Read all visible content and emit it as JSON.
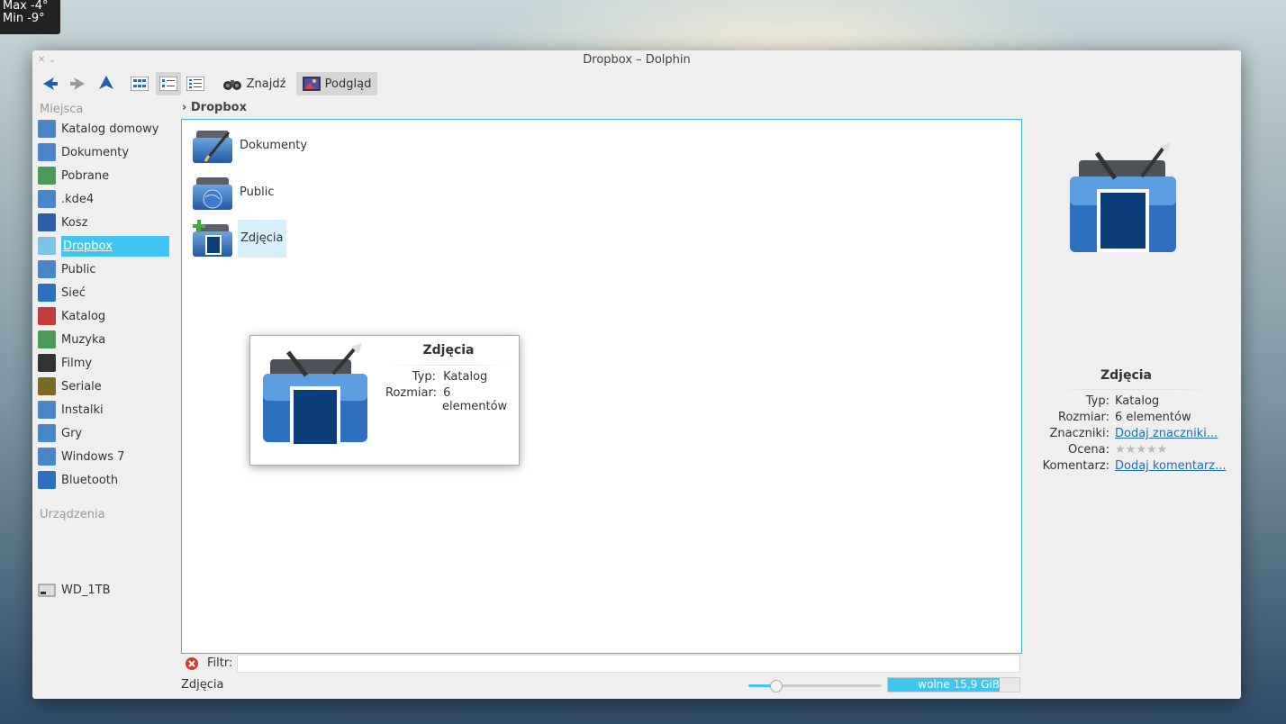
{
  "weather": {
    "max": "Max -4°",
    "min": "Min -9°"
  },
  "window": {
    "title": "Dropbox – Dolphin"
  },
  "toolbar": {
    "find_label": "Znajdź",
    "preview_label": "Podgląd"
  },
  "places": {
    "section_title": "Miejsca",
    "items": [
      {
        "label": "Katalog domowy",
        "icon": "home-folder-icon",
        "color": "#4a86c8"
      },
      {
        "label": "Dokumenty",
        "icon": "documents-folder-icon",
        "color": "#4a86c8"
      },
      {
        "label": "Pobrane",
        "icon": "downloads-folder-icon",
        "color": "#4a9a5a"
      },
      {
        "label": ".kde4",
        "icon": "kde-folder-icon",
        "color": "#4a86c8"
      },
      {
        "label": "Kosz",
        "icon": "trash-icon",
        "color": "#2d5fa8"
      },
      {
        "label": "Dropbox",
        "icon": "dropbox-icon",
        "color": "#7fc2e8"
      },
      {
        "label": "Public",
        "icon": "public-folder-icon",
        "color": "#4a86c8"
      },
      {
        "label": "Sieć",
        "icon": "network-icon",
        "color": "#2d6fbf"
      },
      {
        "label": "Katalog",
        "icon": "red-folder-icon",
        "color": "#c23a3a"
      },
      {
        "label": "Muzyka",
        "icon": "music-folder-icon",
        "color": "#4a9a5a"
      },
      {
        "label": "Filmy",
        "icon": "film-icon",
        "color": "#333333"
      },
      {
        "label": "Seriale",
        "icon": "clapper-icon",
        "color": "#7a6a2a"
      },
      {
        "label": "Instalki",
        "icon": "packages-folder-icon",
        "color": "#4a86c8"
      },
      {
        "label": "Gry",
        "icon": "games-folder-icon",
        "color": "#4a86c8"
      },
      {
        "label": "Windows 7",
        "icon": "windows-folder-icon",
        "color": "#4a86c8"
      },
      {
        "label": "Bluetooth",
        "icon": "bluetooth-icon",
        "color": "#2d6fbf"
      }
    ],
    "devices_title": "Urządzenia",
    "devices": [
      {
        "label": "WD_1TB",
        "icon": "hard-drive-icon",
        "color": "#888888"
      }
    ]
  },
  "breadcrumb": {
    "current": "Dropbox"
  },
  "files": [
    {
      "label": "Dokumenty",
      "icon": "documents-folder-icon"
    },
    {
      "label": "Public",
      "icon": "public-folder-icon"
    },
    {
      "label": "Zdjęcia",
      "icon": "pictures-folder-icon"
    }
  ],
  "tooltip": {
    "title": "Zdjęcia",
    "type_key": "Typ:",
    "type_val": "Katalog",
    "size_key": "Rozmiar:",
    "size_val1": "6",
    "size_val2": "elementów"
  },
  "info_panel": {
    "title": "Zdjęcia",
    "type_key": "Typ:",
    "type_val": "Katalog",
    "size_key": "Rozmiar:",
    "size_val": "6 elementów",
    "tags_key": "Znaczniki:",
    "tags_link": "Dodaj znaczniki...",
    "rating_key": "Ocena:",
    "rating": 0,
    "comment_key": "Komentarz:",
    "comment_link": "Dodaj komentarz..."
  },
  "filter": {
    "label": "Filtr:",
    "value": ""
  },
  "status": {
    "text": "Zdjęcia",
    "free_space": "wolne 15,9 GiB",
    "used_fraction": 0.85,
    "zoom_fraction": 0.2
  },
  "colors": {
    "accent": "#3fc5f0",
    "selection_border": "#3fb5d8"
  }
}
